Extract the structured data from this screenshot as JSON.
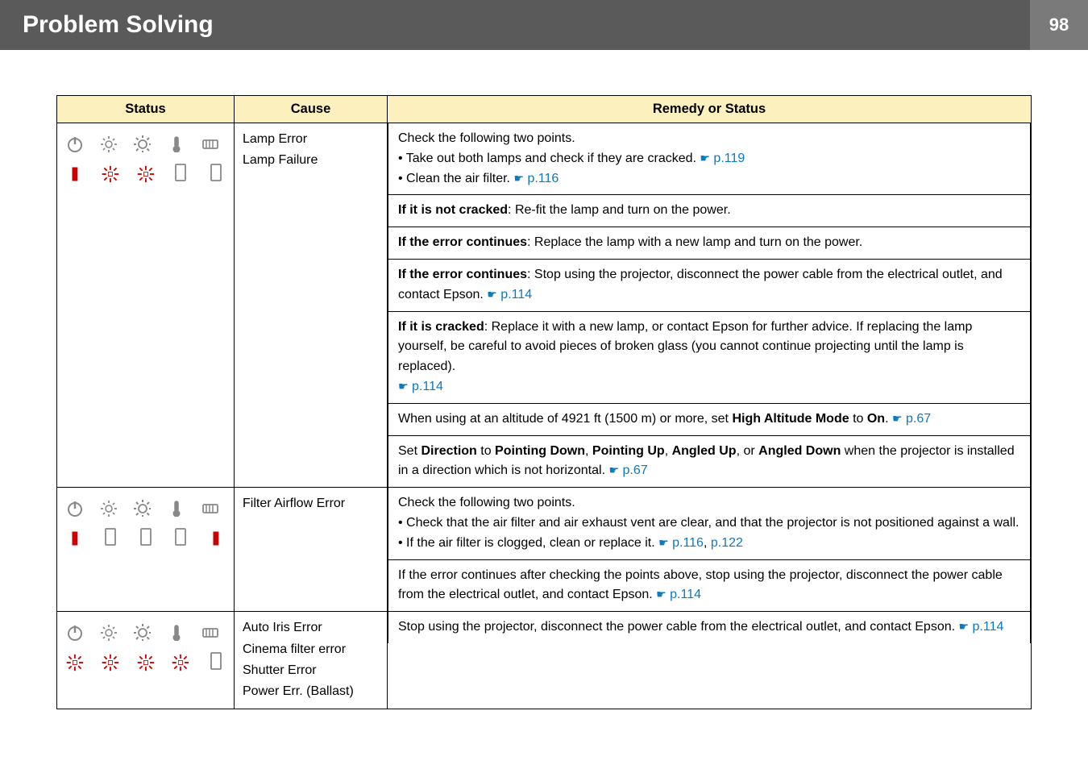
{
  "header": {
    "title": "Problem Solving",
    "page_number": "98"
  },
  "table": {
    "headers": {
      "status": "Status",
      "cause": "Cause",
      "remedy": "Remedy or Status"
    },
    "rows": [
      {
        "causes": [
          "Lamp Error",
          "Lamp Failure"
        ],
        "remedies": [
          {
            "lines": [
              {
                "text": "Check the following two points."
              },
              {
                "prefix": "• Take out both lamps and check if they are cracked. ",
                "link": "p.119"
              },
              {
                "prefix": "• Clean the air filter. ",
                "link": "p.116"
              }
            ]
          },
          {
            "lines": [
              {
                "html": "<b>If it is not cracked</b>: Re-fit the lamp and turn on the power."
              }
            ]
          },
          {
            "lines": [
              {
                "html": "<b>If the error continues</b>: Replace the lamp with a new lamp and turn on the power."
              }
            ]
          },
          {
            "lines": [
              {
                "html": "<b>If the error continues</b>: Stop using the projector, disconnect the power cable from the electrical outlet, and contact Epson. ",
                "link": "p.114"
              }
            ]
          },
          {
            "lines": [
              {
                "html": "<b>If it is cracked</b>: Replace it with a new lamp, or contact Epson for further advice. If replacing the lamp yourself, be careful to avoid pieces of broken glass (you cannot continue projecting until the lamp is replaced). "
              },
              {
                "linkonly": "p.114"
              }
            ]
          },
          {
            "lines": [
              {
                "prefix": "When using at an altitude of 4921 ft (1500 m) or more, set <b>High Altitude Mode</b> to <b>On</b>. ",
                "link": "p.67"
              }
            ]
          },
          {
            "lines": [
              {
                "prefix": "Set <b>Direction</b> to <b>Pointing Down</b>, <b>Pointing Up</b>, <b>Angled Up</b>, or <b>Angled Down</b> when the projector is installed in a direction which is not horizontal. ",
                "link": "p.67"
              }
            ]
          }
        ]
      },
      {
        "causes": [
          "Filter Airflow Error"
        ],
        "remedies": [
          {
            "lines": [
              {
                "text": "Check the following two points."
              },
              {
                "text": "• Check that the air filter and air exhaust vent are clear, and that the projector is not positioned against a wall."
              },
              {
                "prefix": "• If the air filter is clogged, clean or replace it.    ",
                "link": "p.116",
                "extra": ", ",
                "link2": "p.122"
              }
            ]
          },
          {
            "lines": [
              {
                "prefix": "If the error continues after checking the points above, stop using the projector, disconnect the power cable from the electrical outlet, and contact Epson. ",
                "link": "p.114"
              }
            ]
          }
        ]
      },
      {
        "causes": [
          "Auto Iris Error",
          "Cinema filter error",
          "Shutter Error",
          "Power Err. (Ballast)"
        ],
        "remedies": [
          {
            "lines": [
              {
                "prefix": "Stop using the projector, disconnect the power cable from the electrical outlet, and contact Epson. ",
                "link": "p.114"
              }
            ]
          }
        ]
      }
    ]
  }
}
